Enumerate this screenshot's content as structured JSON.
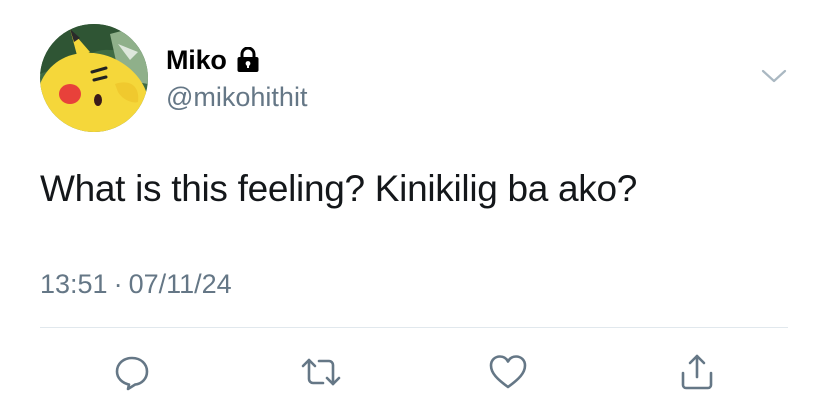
{
  "user": {
    "display_name": "Miko",
    "handle": "@mikohithit",
    "protected": true,
    "avatar_icon": "pikachu-avatar"
  },
  "tweet": {
    "text": "What is this feeling? Kinikilig ba ako?",
    "time": "13:51",
    "separator": "·",
    "date": "07/11/24"
  },
  "actions": [
    {
      "name": "reply",
      "icon": "speech-bubble-icon"
    },
    {
      "name": "retweet",
      "icon": "retweet-arrows-icon"
    },
    {
      "name": "like",
      "icon": "heart-icon"
    },
    {
      "name": "share",
      "icon": "share-upload-icon"
    }
  ],
  "colors": {
    "primary_text": "#14171a",
    "secondary_text": "#657786",
    "divider": "#e1e8ed",
    "icon": "#657786",
    "lock": "#000000"
  }
}
